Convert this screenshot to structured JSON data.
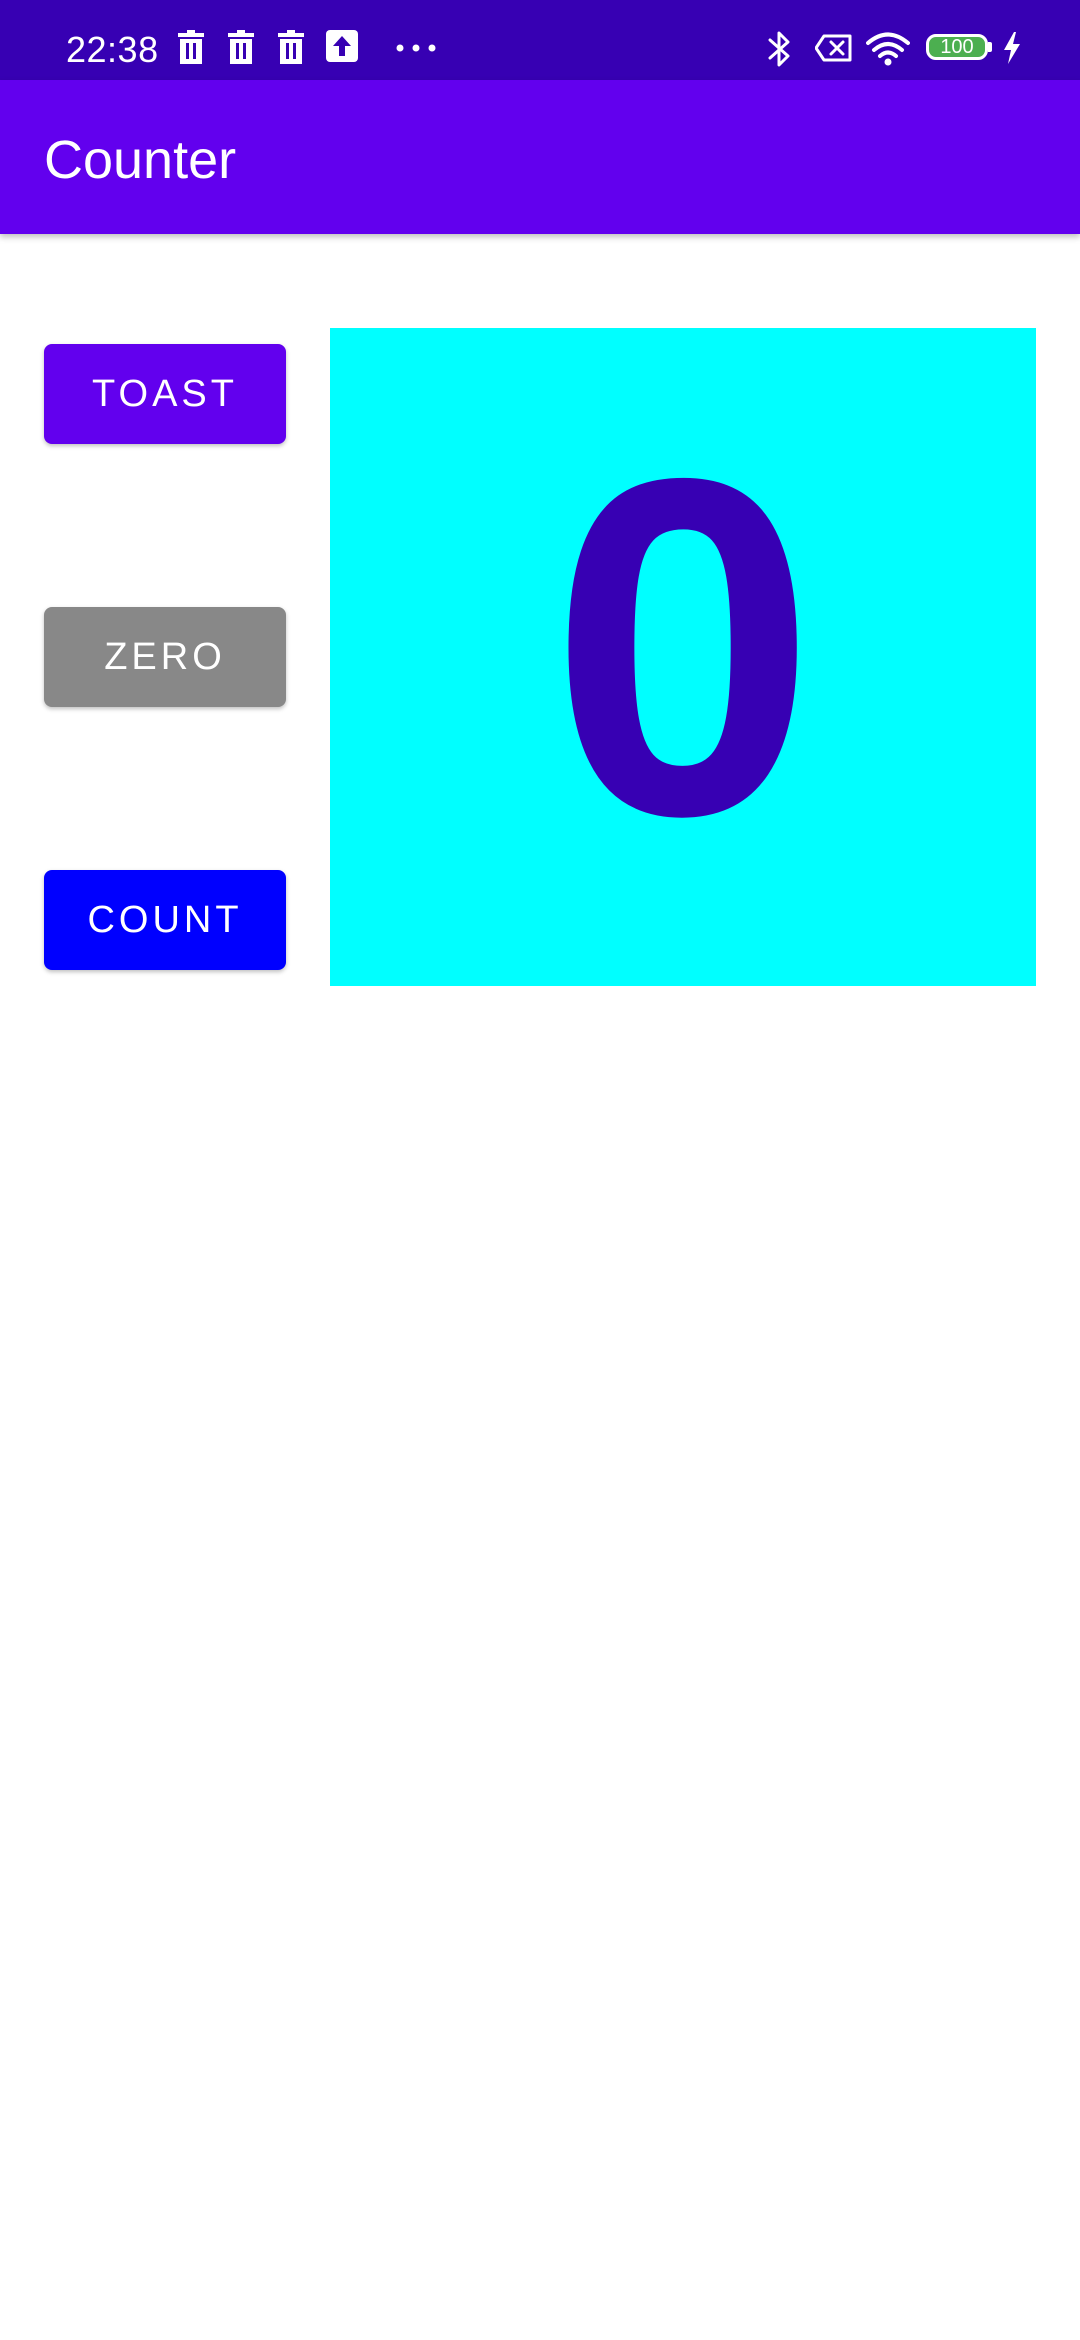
{
  "status_bar": {
    "time": "22:38",
    "battery_level": "100",
    "notification_icons": [
      "trash-icon",
      "trash-icon",
      "trash-icon",
      "upload-icon",
      "more-dots-icon"
    ],
    "system_icons": [
      "bluetooth-icon",
      "data-off-icon",
      "wifi-icon",
      "battery-icon",
      "charging-icon"
    ]
  },
  "app_bar": {
    "title": "Counter"
  },
  "buttons": {
    "toast": "TOAST",
    "zero": "ZERO",
    "count": "COUNT"
  },
  "counter": {
    "value": "0"
  },
  "colors": {
    "status_bar": "#3700b3",
    "app_bar": "#6200ee",
    "toast_button": "#6200ee",
    "zero_button": "#888888",
    "count_button": "#0000ff",
    "count_panel": "#00ffff",
    "count_text": "#3700b3"
  }
}
